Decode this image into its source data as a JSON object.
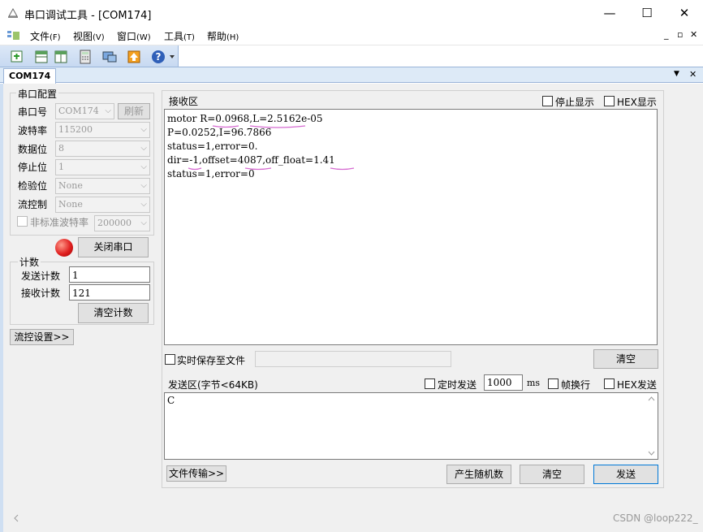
{
  "window": {
    "title": "串口调试工具 - [COM174]",
    "minimize": "—",
    "maximize": "☐",
    "close": "✕"
  },
  "menu": [
    {
      "label": "文件",
      "acc": "(F)"
    },
    {
      "label": "视图",
      "acc": "(V)"
    },
    {
      "label": "窗口",
      "acc": "(W)"
    },
    {
      "label": "工具",
      "acc": "(T)"
    },
    {
      "label": "帮助",
      "acc": "(H)"
    }
  ],
  "mdi": {
    "min": "_",
    "restore": "▫",
    "close": "✕"
  },
  "tab": {
    "label": "COM174",
    "dropdown": "▼",
    "close": "✕"
  },
  "serial_config": {
    "title": "串口配置",
    "port_label": "串口号",
    "port_value": "COM174",
    "refresh_label": "刷新",
    "baud_label": "波特率",
    "baud_value": "115200",
    "databits_label": "数据位",
    "databits_value": "8",
    "stopbits_label": "停止位",
    "stopbits_value": "1",
    "parity_label": "检验位",
    "parity_value": "None",
    "flow_label": "流控制",
    "flow_value": "None",
    "nonstd_label": "非标准波特率",
    "nonstd_value": "200000",
    "open_close_label": "关闭串口",
    "led_color": "#e02020"
  },
  "counter": {
    "title": "计数",
    "send_label": "发送计数",
    "send_value": "1",
    "recv_label": "接收计数",
    "recv_value": "121",
    "clear_label": "清空计数"
  },
  "flow_settings_label": "流控设置>>",
  "receive": {
    "title": "接收区",
    "stop_display_label": "停止显示",
    "hex_display_label": "HEX显示",
    "lines": [
      "motor R=0.0968,L=2.5162e-05",
      "P=0.0252,I=96.7866",
      "status=1,error=0.",
      "dir=-1,offset=4087,off_float=1.41",
      "status=1,error=0"
    ],
    "realtime_save_label": "实时保存至文件",
    "clear_label": "清空"
  },
  "send": {
    "title": "发送区(字节<64KB)",
    "timed_send_label": "定时发送",
    "interval_value": "1000",
    "interval_unit": "ms",
    "newline_label": "帧换行",
    "hex_send_label": "HEX发送",
    "text": "C",
    "file_transfer_label": "文件传输>>",
    "random_label": "产生随机数",
    "clear_label": "清空",
    "send_label": "发送"
  },
  "watermark": "CSDN @loop222_"
}
